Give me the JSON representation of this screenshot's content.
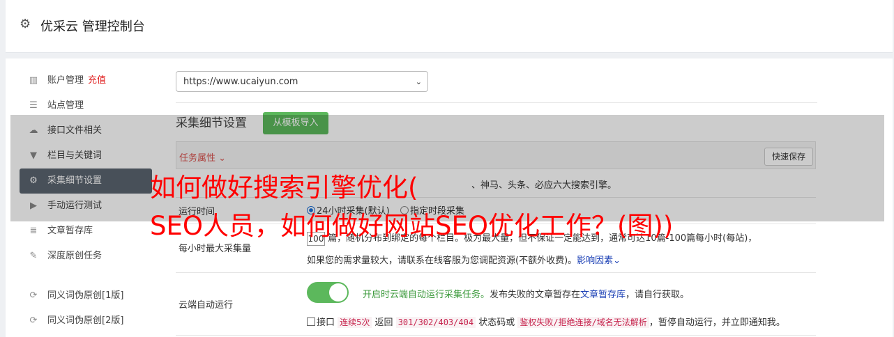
{
  "header": {
    "icon": "gear-icon",
    "title": "优采云 管理控制台"
  },
  "sidebar": {
    "items": [
      {
        "icon": "bar-chart-icon",
        "glyph": "▥",
        "label": "账户管理",
        "extra": "充值"
      },
      {
        "icon": "server-icon",
        "glyph": "☰",
        "label": "站点管理"
      },
      {
        "icon": "cloud-upload-icon",
        "glyph": "☁",
        "label": "接口文件相关"
      },
      {
        "icon": "filter-icon",
        "glyph": "▼",
        "label": "栏目与关键词"
      },
      {
        "icon": "cogs-icon",
        "glyph": "⚙",
        "label": "采集细节设置"
      },
      {
        "icon": "play-icon",
        "glyph": "▶",
        "label": "手动运行测试"
      },
      {
        "icon": "database-icon",
        "glyph": "≣",
        "label": "文章暂存库"
      },
      {
        "icon": "edit-icon",
        "glyph": "✎",
        "label": "深度原创任务"
      },
      {
        "icon": "refresh-icon",
        "glyph": "⟳",
        "label": "同义词伪原创[1版]"
      },
      {
        "icon": "refresh-icon",
        "glyph": "⟳",
        "label": "同义词伪原创[2版]"
      }
    ]
  },
  "site_select": {
    "value": "https://www.ucaiyun.com",
    "chevron": "⌄"
  },
  "section": {
    "title": "采集细节设置",
    "import_button": "从模板导入"
  },
  "task": {
    "label": "任务属性 ⌄",
    "save_button": "快速保存"
  },
  "rows": {
    "engines_text": "、神马、头条、必应六大搜索引擎。",
    "runtime_label": "运行时间",
    "runtime_opt1": "24小时采集(默认)",
    "runtime_opt2": "指定时段采集",
    "maxcollect_label": "每小时最大采集量",
    "maxcollect_value": "100",
    "maxcollect_text1": "篇，随机分布到绑定的每个栏目。极为最大量，但不保证一定能达到，通常可达10篇-100篇每小时(每站)，",
    "maxcollect_text2": "如果您的需求量较大，请联系在线客服为您调配资源(不额外收费)。",
    "maxcollect_link": "影响因素",
    "autorun_label": "云端自动运行",
    "autorun_green": "开启时云端自动运行采集任务。",
    "autorun_text": "发布失败的文章暂存在",
    "autorun_link": "文章暂存库",
    "autorun_text2": "，请自行获取。",
    "iface_prefix": "接口",
    "iface_code1": "连续5次",
    "iface_mid1": "返回",
    "iface_code2": "301/302/403/404",
    "iface_mid2": "状态码或",
    "iface_code3": "鉴权失败/拒绝连接/域名无法解析",
    "iface_suffix": "，暂停自动运行，并立即通知我。"
  },
  "overlay": {
    "line1": "如何做好搜索引擎优化(",
    "line2": "SEO人员，如何做好网站SEO优化工作？(图))"
  }
}
